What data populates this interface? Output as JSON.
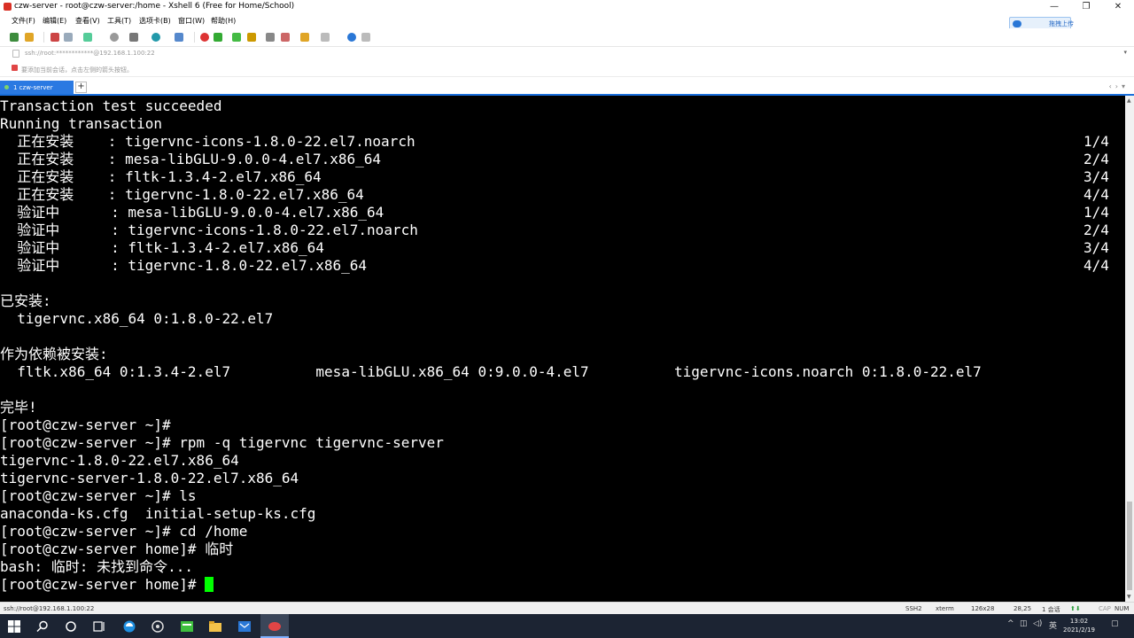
{
  "window": {
    "title": "czw-server - root@czw-server:/home - Xshell 6 (Free for Home/School)",
    "controls": {
      "minimize": "—",
      "restore": "❐",
      "close": "✕"
    }
  },
  "menu": [
    "文件(F)",
    "编辑(E)",
    "查看(V)",
    "工具(T)",
    "选项卡(B)",
    "窗口(W)",
    "帮助(H)"
  ],
  "cloud_button": {
    "label": "拖拽上传",
    "icon": "cloud-icon"
  },
  "address_bar": {
    "text": "ssh://root:************@192.168.1.100:22"
  },
  "hint_bar": {
    "text": "要添加当前会话，点击左侧的箭头按钮。"
  },
  "tabs": [
    {
      "label": "1 czw-server",
      "active": true
    }
  ],
  "terminal": {
    "lines": [
      {
        "text": "Transaction test succeeded",
        "counter": ""
      },
      {
        "text": "Running transaction",
        "counter": ""
      },
      {
        "text": "  正在安装    : tigervnc-icons-1.8.0-22.el7.noarch",
        "counter": "1/4"
      },
      {
        "text": "  正在安装    : mesa-libGLU-9.0.0-4.el7.x86_64",
        "counter": "2/4"
      },
      {
        "text": "  正在安装    : fltk-1.3.4-2.el7.x86_64",
        "counter": "3/4"
      },
      {
        "text": "  正在安装    : tigervnc-1.8.0-22.el7.x86_64",
        "counter": "4/4"
      },
      {
        "text": "  验证中      : mesa-libGLU-9.0.0-4.el7.x86_64",
        "counter": "1/4"
      },
      {
        "text": "  验证中      : tigervnc-icons-1.8.0-22.el7.noarch",
        "counter": "2/4"
      },
      {
        "text": "  验证中      : fltk-1.3.4-2.el7.x86_64",
        "counter": "3/4"
      },
      {
        "text": "  验证中      : tigervnc-1.8.0-22.el7.x86_64",
        "counter": "4/4"
      },
      {
        "text": "",
        "counter": ""
      },
      {
        "text": "已安装:",
        "counter": ""
      },
      {
        "text": "  tigervnc.x86_64 0:1.8.0-22.el7",
        "counter": ""
      },
      {
        "text": "",
        "counter": ""
      },
      {
        "text": "作为依赖被安装:",
        "counter": ""
      },
      {
        "text": "  fltk.x86_64 0:1.3.4-2.el7          mesa-libGLU.x86_64 0:9.0.0-4.el7          tigervnc-icons.noarch 0:1.8.0-22.el7",
        "counter": ""
      },
      {
        "text": "",
        "counter": ""
      },
      {
        "text": "完毕!",
        "counter": ""
      },
      {
        "text": "[root@czw-server ~]#",
        "counter": ""
      },
      {
        "text": "[root@czw-server ~]# rpm -q tigervnc tigervnc-server",
        "counter": ""
      },
      {
        "text": "tigervnc-1.8.0-22.el7.x86_64",
        "counter": ""
      },
      {
        "text": "tigervnc-server-1.8.0-22.el7.x86_64",
        "counter": ""
      },
      {
        "text": "[root@czw-server ~]# ls",
        "counter": ""
      },
      {
        "text": "anaconda-ks.cfg  initial-setup-ks.cfg",
        "counter": ""
      },
      {
        "text": "[root@czw-server ~]# cd /home",
        "counter": ""
      },
      {
        "text": "[root@czw-server home]# 临时",
        "counter": ""
      },
      {
        "text": "bash: 临时: 未找到命令...",
        "counter": ""
      }
    ],
    "prompt": "[root@czw-server home]# "
  },
  "status_bar": {
    "connection": "ssh://root@192.168.1.100:22",
    "protocol": "SSH2",
    "terminal_type": "xterm",
    "size": "126x28",
    "cursor_pos": "28,25",
    "sessions": "1 会话",
    "caps": "CAP",
    "num": "NUM"
  },
  "taskbar": {
    "clock_time": "13:02",
    "clock_date": "2021/2/19",
    "ime": "英"
  }
}
